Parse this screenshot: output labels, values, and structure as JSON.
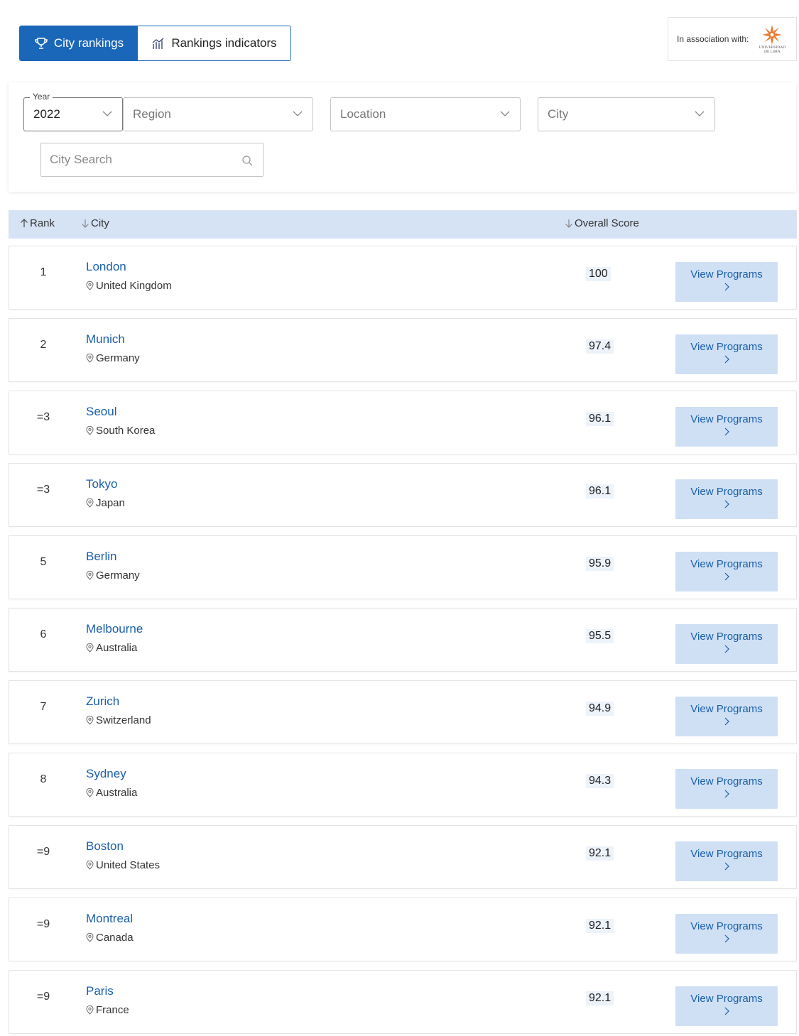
{
  "tabs": {
    "city_rankings": "City rankings",
    "rankings_indicators": "Rankings indicators"
  },
  "association": {
    "label": "In association with:",
    "logo_text_line1": "UNIVERSIDAD",
    "logo_text_line2": "DE LIMA",
    "logo_icon": "sunburst-logo-icon",
    "logo_color": "#e8772e"
  },
  "filters": {
    "year_label": "Year",
    "year_value": "2022",
    "region": "Region",
    "location": "Location",
    "city": "City",
    "search_placeholder": "City Search"
  },
  "table": {
    "headers": {
      "rank": "Rank",
      "city": "City",
      "overall_score": "Overall Score"
    },
    "view_programs_label": "View Programs",
    "rows": [
      {
        "rank": "1",
        "city": "London",
        "country": "United Kingdom",
        "score": "100"
      },
      {
        "rank": "2",
        "city": "Munich",
        "country": "Germany",
        "score": "97.4"
      },
      {
        "rank": "=3",
        "city": "Seoul",
        "country": "South Korea",
        "score": "96.1"
      },
      {
        "rank": "=3",
        "city": "Tokyo",
        "country": "Japan",
        "score": "96.1"
      },
      {
        "rank": "5",
        "city": "Berlin",
        "country": "Germany",
        "score": "95.9"
      },
      {
        "rank": "6",
        "city": "Melbourne",
        "country": "Australia",
        "score": "95.5"
      },
      {
        "rank": "7",
        "city": "Zurich",
        "country": "Switzerland",
        "score": "94.9"
      },
      {
        "rank": "8",
        "city": "Sydney",
        "country": "Australia",
        "score": "94.3"
      },
      {
        "rank": "=9",
        "city": "Boston",
        "country": "United States",
        "score": "92.1"
      },
      {
        "rank": "=9",
        "city": "Montreal",
        "country": "Canada",
        "score": "92.1"
      },
      {
        "rank": "=9",
        "city": "Paris",
        "country": "France",
        "score": "92.1"
      }
    ]
  },
  "colors": {
    "primary": "#1a66b8",
    "header_bg": "#d5e3f5",
    "button_bg": "#cfe0f5",
    "link": "#1a5fa8"
  }
}
